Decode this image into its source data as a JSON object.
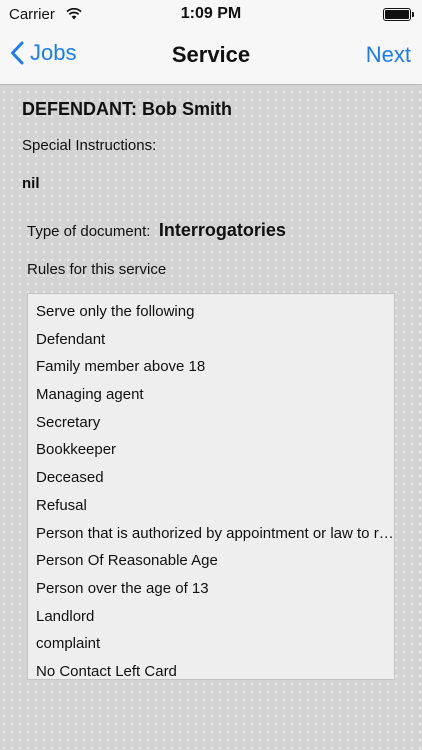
{
  "status_bar": {
    "carrier": "Carrier",
    "time": "1:09 PM"
  },
  "nav": {
    "back_label": "Jobs",
    "title": "Service",
    "next_label": "Next"
  },
  "defendant": {
    "text": "DEFENDANT: Bob Smith"
  },
  "special_instructions": {
    "label": "Special Instructions:",
    "value": "nil"
  },
  "document": {
    "label": "Type of document:",
    "value": "Interrogatories"
  },
  "rules": {
    "label": "Rules for this service",
    "items": [
      "Serve only the following",
      "Defendant",
      "Family member above 18",
      "Managing agent",
      "Secretary",
      "Bookkeeper",
      "Deceased",
      "Refusal",
      "Person that is authorized by appointment or law to receive service",
      "Person Of Reasonable Age",
      "Person over the age of 13",
      "Landlord",
      "complaint",
      "No Contact Left Card"
    ]
  },
  "colors": {
    "accent": "#1b7cf5",
    "bar": "#f7f7f7"
  }
}
